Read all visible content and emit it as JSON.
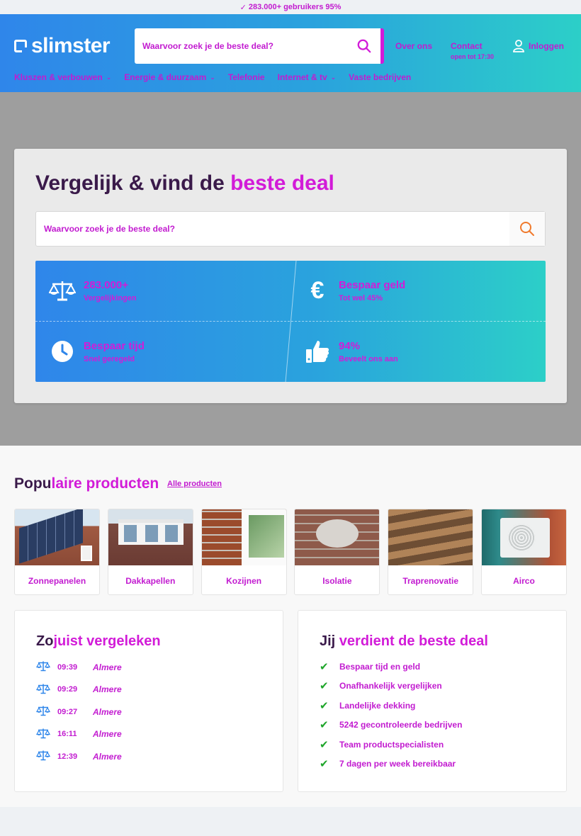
{
  "topbar": {
    "text": "283.000+ gebruikers 95%"
  },
  "header": {
    "logo": "slimster",
    "search_placeholder": "Waarvoor zoek je de beste deal?",
    "links": {
      "about": "Over ons",
      "contact": "Contact",
      "contact_sub": "open tot 17:30",
      "login": "Inloggen"
    },
    "nav": [
      {
        "label": "Kluszen & verbouwen",
        "has_dropdown": true
      },
      {
        "label": "Energie & duurzaam",
        "has_dropdown": true
      },
      {
        "label": "Telefonie",
        "has_dropdown": false
      },
      {
        "label": "Internet & tv",
        "has_dropdown": true
      },
      {
        "label": "Vaste bedrijven",
        "has_dropdown": false
      }
    ]
  },
  "hero": {
    "title_main": "Vergelijk & vind de ",
    "title_accent": "beste deal",
    "search_placeholder": "Waarvoor zoek je de beste deal?",
    "stats": [
      {
        "icon": "scale-icon",
        "big": "283.000+",
        "small": "Vergelijkingen"
      },
      {
        "icon": "euro-icon",
        "big": "Bespaar geld",
        "small": "Tot wel 45%"
      },
      {
        "icon": "clock-icon",
        "big": "Bespaar tijd",
        "small": "Snel geregeld"
      },
      {
        "icon": "thumbs-up-icon",
        "big": "94%",
        "small": "Beveelt ons aan"
      }
    ]
  },
  "popular": {
    "title_main": "Popu",
    "title_accent": "laire producten",
    "all_link": "Alle producten",
    "items": [
      {
        "label": "Zonnepanelen"
      },
      {
        "label": "Dakkapellen"
      },
      {
        "label": "Kozijnen"
      },
      {
        "label": "Isolatie"
      },
      {
        "label": "Traprenovatie"
      },
      {
        "label": "Airco"
      }
    ]
  },
  "recent": {
    "title_main": "Zo",
    "title_accent": "juist vergeleken",
    "rows": [
      {
        "time": "09:39",
        "city": "Almere"
      },
      {
        "time": "09:29",
        "city": "Almere"
      },
      {
        "time": "09:27",
        "city": "Almere"
      },
      {
        "time": "16:11",
        "city": "Almere"
      },
      {
        "time": "12:39",
        "city": "Almere"
      }
    ]
  },
  "benefits": {
    "title_main": "Jij ",
    "title_accent": "verdient de beste deal",
    "items": [
      "Bespaar tijd en geld",
      "Onafhankelijk vergelijken",
      "Landelijke dekking",
      "5242 gecontroleerde bedrijven",
      "Team productspecialisten",
      "7 dagen per week bereikbaar"
    ]
  },
  "colors": {
    "accent": "#d21bd8",
    "brand_blue": "#2f86ea",
    "brand_teal": "#2ccfc8",
    "hero_bg": "#9e9e9e",
    "check": "#1fa52a"
  }
}
